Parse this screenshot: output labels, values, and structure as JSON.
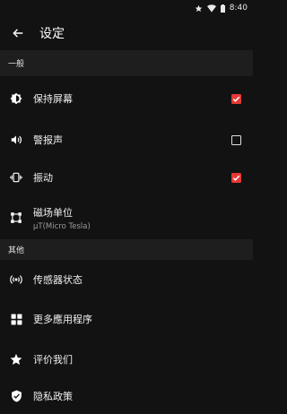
{
  "status": {
    "time": "8:40"
  },
  "toolbar": {
    "title": "设定"
  },
  "sections": [
    {
      "label": "一般"
    },
    {
      "label": "其他"
    }
  ],
  "general": [
    {
      "icon": "brightness-icon",
      "label": "保持屏幕",
      "checked": true
    },
    {
      "icon": "volume-icon",
      "label": "警报声",
      "checked": false
    },
    {
      "icon": "vibration-icon",
      "label": "振动",
      "checked": true
    },
    {
      "icon": "magnet-unit-icon",
      "label": "磁场单位",
      "value": "μT(Micro Tesla)"
    }
  ],
  "other": [
    {
      "icon": "sensor-status-icon",
      "label": "传感器状态"
    },
    {
      "icon": "apps-grid-icon",
      "label": "更多應用程序"
    },
    {
      "icon": "star-icon",
      "label": "评价我们"
    },
    {
      "icon": "shield-icon",
      "label": "隐私政策"
    }
  ],
  "colors": {
    "accent": "#e53935",
    "background": "#121212",
    "section": "#1e1e1e"
  }
}
